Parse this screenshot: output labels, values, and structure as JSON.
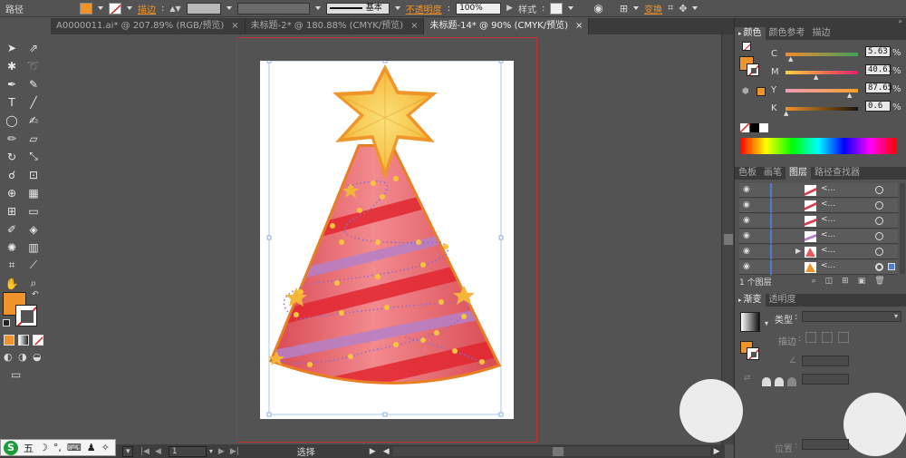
{
  "control_bar": {
    "object_type": "路径",
    "stroke_label": "描边",
    "stroke_profile": "基本",
    "opacity_label": "不透明度",
    "opacity_value": "100%",
    "style_label": "样式",
    "transform_label": "变换"
  },
  "tabs": [
    {
      "label": "A0000011.ai* @ 207.89% (RGB/预览)",
      "close": "×",
      "active": false
    },
    {
      "label": "未标题-2* @ 180.88% (CMYK/预览)",
      "close": "×",
      "active": false
    },
    {
      "label": "未标题-14* @ 90% (CMYK/预览)",
      "close": "×",
      "active": true
    }
  ],
  "color_panel": {
    "tabs": [
      "颜色",
      "颜色参考",
      "描边"
    ],
    "channels": [
      {
        "label": "C",
        "value": "5.63",
        "unit": "%",
        "level": 0.056
      },
      {
        "label": "M",
        "value": "40.61",
        "unit": "%",
        "level": 0.406
      },
      {
        "label": "Y",
        "value": "87.65",
        "unit": "%",
        "level": 0.876
      },
      {
        "label": "K",
        "value": "0.6",
        "unit": "%",
        "level": 0.006
      }
    ],
    "fill_color": "#f0932b"
  },
  "layers_panel": {
    "tabs": [
      "色板",
      "画笔",
      "图层",
      "路径查找器"
    ],
    "rows": [
      {
        "name": "<...",
        "thumb": "stripe"
      },
      {
        "name": "<...",
        "thumb": "stripe"
      },
      {
        "name": "<...",
        "thumb": "stripe"
      },
      {
        "name": "<...",
        "thumb": "stripe"
      },
      {
        "name": "<...",
        "thumb": "cone"
      },
      {
        "name": "<...",
        "thumb": "cone-orange"
      }
    ],
    "footer": "1 个图层"
  },
  "gradient_panel": {
    "tabs": [
      "渐变",
      "透明度"
    ],
    "type_label": "类型",
    "stroke_label": "描边",
    "position_label": "位置"
  },
  "status_bar": {
    "page": "1",
    "tool": "选择"
  },
  "ime": {
    "logo": "S",
    "mode": "五"
  },
  "colors": {
    "accent": "#f0932b",
    "cone": "#e5575b",
    "star": "#f7c13f",
    "border": "#c03030"
  }
}
